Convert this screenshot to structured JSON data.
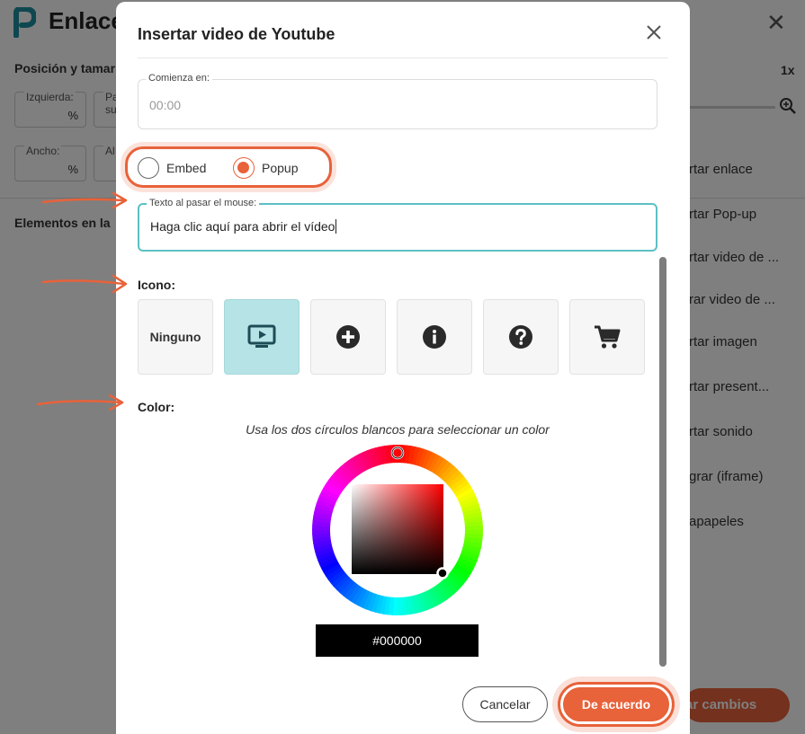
{
  "background": {
    "title": "Enlace",
    "position_section": "Posición y tamar",
    "fields": [
      {
        "label": "Izquierda:",
        "unit": "%"
      },
      {
        "label": "Pa su",
        "unit": ""
      },
      {
        "label": "Ancho:",
        "unit": "%"
      },
      {
        "label": "Al",
        "unit": ""
      }
    ],
    "elements_section": "Elementos en la",
    "zoom": "1x",
    "menu_items": [
      "rtar enlace",
      "rtar Pop-up",
      "rtar video de ...",
      "rar video de ...",
      "rtar imagen",
      "rtar present...",
      "rtar sonido",
      "grar (iframe)",
      "apapeles"
    ],
    "save_label": "ar cambios"
  },
  "modal": {
    "title": "Insertar video de Youtube",
    "start_field": {
      "label": "Comienza en:",
      "placeholder": "00:00"
    },
    "display_mode": {
      "options": [
        {
          "label": "Embed",
          "checked": false
        },
        {
          "label": "Popup",
          "checked": true
        }
      ]
    },
    "hover_field": {
      "label": "Texto al pasar el mouse:",
      "value": "Haga clic aquí para abrir el vídeo"
    },
    "icon_section": {
      "label": "Icono:",
      "options": [
        {
          "name": "none",
          "label": "Ninguno",
          "selected": false
        },
        {
          "name": "video-screen-icon",
          "selected": true
        },
        {
          "name": "plus-circle-icon",
          "selected": false
        },
        {
          "name": "info-circle-icon",
          "selected": false
        },
        {
          "name": "question-circle-icon",
          "selected": false
        },
        {
          "name": "shopping-cart-icon",
          "selected": false
        }
      ]
    },
    "color_section": {
      "label": "Color:",
      "hint": "Usa los dos círculos blancos para seleccionar un color",
      "hex": "#000000"
    },
    "buttons": {
      "cancel": "Cancelar",
      "ok": "De acuerdo"
    }
  },
  "colors": {
    "accent": "#e8623a",
    "selected_tile": "#b6e4e6",
    "focus_border": "#5cc0c4"
  }
}
